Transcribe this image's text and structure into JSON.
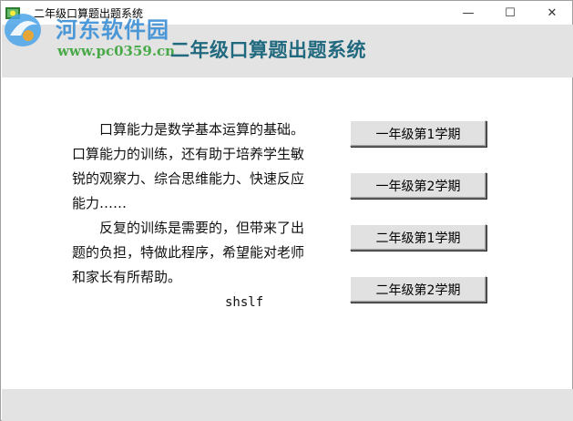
{
  "window": {
    "title": "二年级口算题出题系统",
    "minimize_glyph": "—",
    "maximize_glyph": "☐",
    "close_glyph": "✕"
  },
  "watermark": {
    "name": "河东软件园",
    "url": "www.pc0359.cn"
  },
  "header": {
    "title": "二年级口算题出题系统"
  },
  "intro": {
    "paragraph1": "口算能力是数学基本运算的基础。口算能力的训练，还有助于培养学生敏锐的观察力、综合思维能力、快速反应能力……",
    "paragraph2": "反复的训练是需要的，但带来了出题的负担，特做此程序，希望能对老师和家长有所帮助。",
    "signature": "shslf"
  },
  "menu": {
    "buttons": [
      {
        "label": "一年级第1学期"
      },
      {
        "label": "一年级第2学期"
      },
      {
        "label": "二年级第1学期"
      },
      {
        "label": "二年级第2学期"
      }
    ]
  },
  "colors": {
    "header_title": "#20697e",
    "band": "#e3e3e3",
    "watermark_blue": "#3a8fd6",
    "watermark_green": "#2fa02f"
  }
}
